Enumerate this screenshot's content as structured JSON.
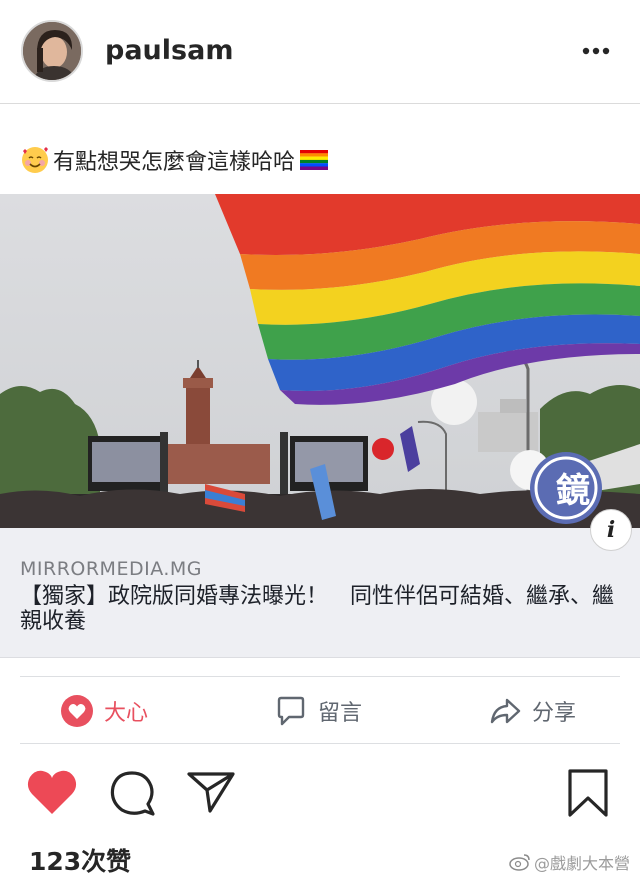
{
  "post": {
    "username": "paulsam",
    "caption": "有點想哭怎麼會這樣哈哈"
  },
  "link_card": {
    "domain": "MIRRORMEDIA.MG",
    "title": "【獨家】政院版同婚專法曝光！　同性伴侶可結婚、繼承、繼親收養",
    "info_label": "i"
  },
  "fb_actions": {
    "love_label": "大心",
    "comment_label": "留言",
    "share_label": "分享"
  },
  "likes_text": "123次赞",
  "watermark_text": "@戲劇大本營",
  "icons": {
    "more": "more-icon",
    "heart": "heart-icon",
    "comment": "comment-icon",
    "share": "send-icon",
    "save": "bookmark-icon",
    "info": "info-icon"
  },
  "colors": {
    "heart": "#ed4956",
    "fb_love": "#e8505f",
    "card_bg": "#eeeff3"
  }
}
